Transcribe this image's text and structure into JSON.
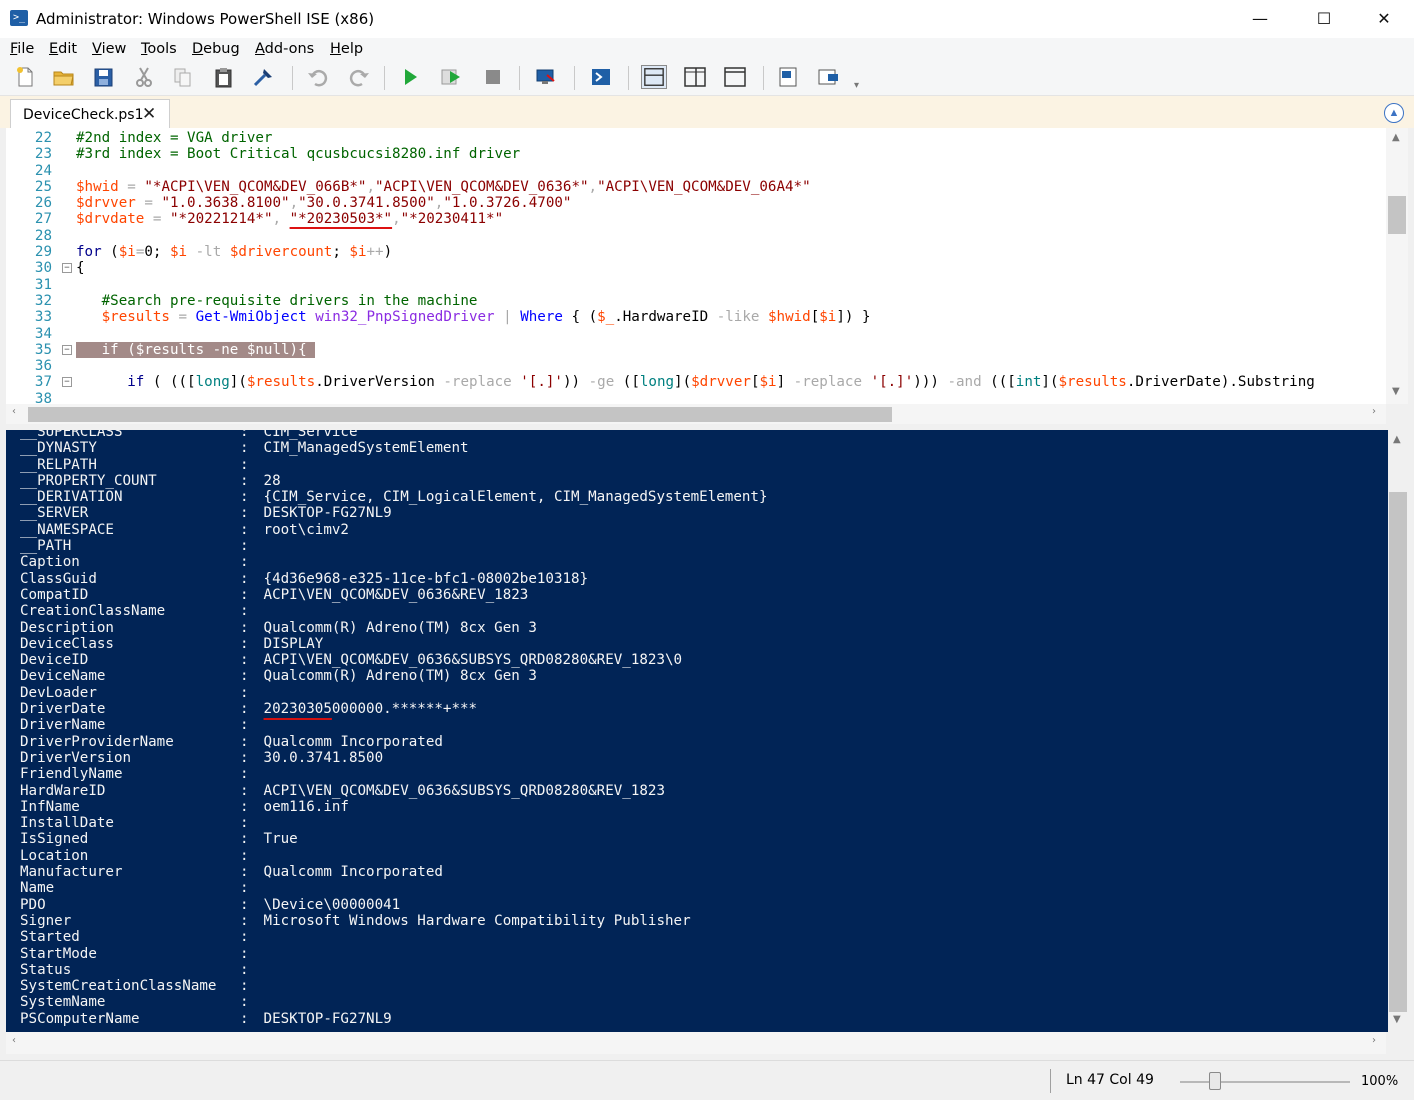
{
  "window": {
    "title": "Administrator: Windows PowerShell ISE (x86)",
    "minimize": "—",
    "maximize": "☐",
    "close": "✕"
  },
  "menu": [
    "File",
    "Edit",
    "View",
    "Tools",
    "Debug",
    "Add-ons",
    "Help"
  ],
  "tab": {
    "label": "DeviceCheck.ps1",
    "close": "✕"
  },
  "editor_lines": [
    {
      "n": "22",
      "fold": "",
      "html": "<span class=\"cm\">#2nd index = VGA driver</span>"
    },
    {
      "n": "23",
      "fold": "",
      "html": "<span class=\"cm\">#3rd index = Boot Critical qcusbcucsi8280.inf driver</span>"
    },
    {
      "n": "24",
      "fold": "",
      "html": ""
    },
    {
      "n": "25",
      "fold": "",
      "html": "<span class=\"vr\">$hwid</span> <span class=\"op\">=</span> <span class=\"st\">\"*ACPI\\VEN_QCOM&amp;DEV_066B*\"</span><span class=\"op\">,</span><span class=\"st\">\"ACPI\\VEN_QCOM&amp;DEV_0636*\"</span><span class=\"op\">,</span><span class=\"st\">\"ACPI\\VEN_QCOM&amp;DEV_06A4*\"</span>"
    },
    {
      "n": "26",
      "fold": "",
      "html": "<span class=\"vr\">$drvver</span> <span class=\"op\">=</span> <span class=\"st\">\"1.0.3638.8100\"</span><span class=\"op\">,</span><span class=\"st\">\"30.0.3741.8500\"</span><span class=\"op\">,</span><span class=\"st\">\"1.0.3726.4700\"</span>"
    },
    {
      "n": "27",
      "fold": "",
      "html": "<span class=\"vr\">$drvdate</span> <span class=\"op\">=</span> <span class=\"st\">\"*20221214*\"</span><span class=\"op\">,</span> <span class=\"st ul-red\">\"*20230503*\"</span><span class=\"op\">,</span><span class=\"st\">\"*20230411*\"</span>"
    },
    {
      "n": "28",
      "fold": "",
      "html": ""
    },
    {
      "n": "29",
      "fold": "",
      "html": "<span class=\"kw\">for</span> <span class=\"mb\">(</span><span class=\"vr\">$i</span><span class=\"op\">=</span><span class=\"mb\">0;</span> <span class=\"vr\">$i</span> <span class=\"op\">-lt</span> <span class=\"vr\">$drivercount</span><span class=\"mb\">;</span> <span class=\"vr\">$i</span><span class=\"op\">++</span><span class=\"mb\">)</span>"
    },
    {
      "n": "30",
      "fold": "−",
      "html": "<span class=\"mb\">{</span>"
    },
    {
      "n": "31",
      "fold": "",
      "html": ""
    },
    {
      "n": "32",
      "fold": "",
      "html": "   <span class=\"cm\">#Search pre-requisite drivers in the machine</span>"
    },
    {
      "n": "33",
      "fold": "",
      "html": "   <span class=\"vr\">$results</span> <span class=\"op\">=</span> <span class=\"cmd\">Get-WmiObject</span> <span class=\"pm\" style=\"color:#8a2be2\">win32_PnpSignedDriver</span> <span class=\"op\">|</span> <span class=\"cmd\">Where</span> <span class=\"mb\">{ (</span><span class=\"vr\">$_</span><span class=\"mb\">.HardwareID</span> <span class=\"op\">-like</span> <span class=\"vr\">$hwid</span><span class=\"mb\">[</span><span class=\"vr\">$i</span><span class=\"mb\">]) }</span>"
    },
    {
      "n": "34",
      "fold": "",
      "html": ""
    },
    {
      "n": "35",
      "fold": "−",
      "html": "<span class=\"hl\">   if ($results -ne $null){ </span>"
    },
    {
      "n": "36",
      "fold": "",
      "html": ""
    },
    {
      "n": "37",
      "fold": "−",
      "html": "      <span class=\"kw\">if</span> <span class=\"mb\">( (([</span><span class=\"ty\">long</span><span class=\"mb\">](</span><span class=\"vr\">$results</span><span class=\"mb\">.DriverVersion</span> <span class=\"op\">-replace</span> <span class=\"st\">'[.]'</span><span class=\"mb\">))</span> <span class=\"op\">-ge</span> <span class=\"mb\">([</span><span class=\"ty\">long</span><span class=\"mb\">](</span><span class=\"vr\">$drvver</span><span class=\"mb\">[</span><span class=\"vr\">$i</span><span class=\"mb\">]</span> <span class=\"op\">-replace</span> <span class=\"st\">'[.]'</span><span class=\"mb\">)))</span> <span class=\"op\">-and</span> <span class=\"mb\">(([</span><span class=\"ty\">int</span><span class=\"mb\">](</span><span class=\"vr\">$results</span><span class=\"mb\">.DriverDate).Substring</span>"
    },
    {
      "n": "38",
      "fold": "",
      "html": ""
    }
  ],
  "console_rows": [
    {
      "k": "__SUPERCLASS",
      "v": "CIM_Service"
    },
    {
      "k": "__DYNASTY",
      "v": "CIM_ManagedSystemElement"
    },
    {
      "k": "__RELPATH",
      "v": ""
    },
    {
      "k": "__PROPERTY_COUNT",
      "v": "28"
    },
    {
      "k": "__DERIVATION",
      "v": "{CIM_Service, CIM_LogicalElement, CIM_ManagedSystemElement}"
    },
    {
      "k": "__SERVER",
      "v": "DESKTOP-FG27NL9"
    },
    {
      "k": "__NAMESPACE",
      "v": "root\\cimv2"
    },
    {
      "k": "__PATH",
      "v": ""
    },
    {
      "k": "Caption",
      "v": ""
    },
    {
      "k": "ClassGuid",
      "v": "{4d36e968-e325-11ce-bfc1-08002be10318}"
    },
    {
      "k": "CompatID",
      "v": "ACPI\\VEN_QCOM&DEV_0636&REV_1823"
    },
    {
      "k": "CreationClassName",
      "v": ""
    },
    {
      "k": "Description",
      "v": "Qualcomm(R) Adreno(TM) 8cx Gen 3"
    },
    {
      "k": "DeviceClass",
      "v": "DISPLAY"
    },
    {
      "k": "DeviceID",
      "v": "ACPI\\VEN_QCOM&DEV_0636&SUBSYS_QRD08280&REV_1823\\0"
    },
    {
      "k": "DeviceName",
      "v": "Qualcomm(R) Adreno(TM) 8cx Gen 3"
    },
    {
      "k": "DevLoader",
      "v": ""
    },
    {
      "k": "DriverDate",
      "v": "20230305000000.******+***",
      "mark": "20230305"
    },
    {
      "k": "DriverName",
      "v": ""
    },
    {
      "k": "DriverProviderName",
      "v": "Qualcomm Incorporated"
    },
    {
      "k": "DriverVersion",
      "v": "30.0.3741.8500"
    },
    {
      "k": "FriendlyName",
      "v": ""
    },
    {
      "k": "HardWareID",
      "v": "ACPI\\VEN_QCOM&DEV_0636&SUBSYS_QRD08280&REV_1823"
    },
    {
      "k": "InfName",
      "v": "oem116.inf"
    },
    {
      "k": "InstallDate",
      "v": ""
    },
    {
      "k": "IsSigned",
      "v": "True"
    },
    {
      "k": "Location",
      "v": ""
    },
    {
      "k": "Manufacturer",
      "v": "Qualcomm Incorporated"
    },
    {
      "k": "Name",
      "v": ""
    },
    {
      "k": "PDO",
      "v": "\\Device\\00000041"
    },
    {
      "k": "Signer",
      "v": "Microsoft Windows Hardware Compatibility Publisher"
    },
    {
      "k": "Started",
      "v": ""
    },
    {
      "k": "StartMode",
      "v": ""
    },
    {
      "k": "Status",
      "v": ""
    },
    {
      "k": "SystemCreationClassName",
      "v": ""
    },
    {
      "k": "SystemName",
      "v": ""
    },
    {
      "k": "PSComputerName",
      "v": "DESKTOP-FG27NL9"
    }
  ],
  "status": {
    "position": "Ln 47  Col 49",
    "zoom": "100%",
    "zoom_level": 100
  },
  "colors": {
    "console_bg": "#012456",
    "accent_blue": "#1f5fa6",
    "tab_strip": "#fbf3e3",
    "underline_mark": "#d11111"
  }
}
